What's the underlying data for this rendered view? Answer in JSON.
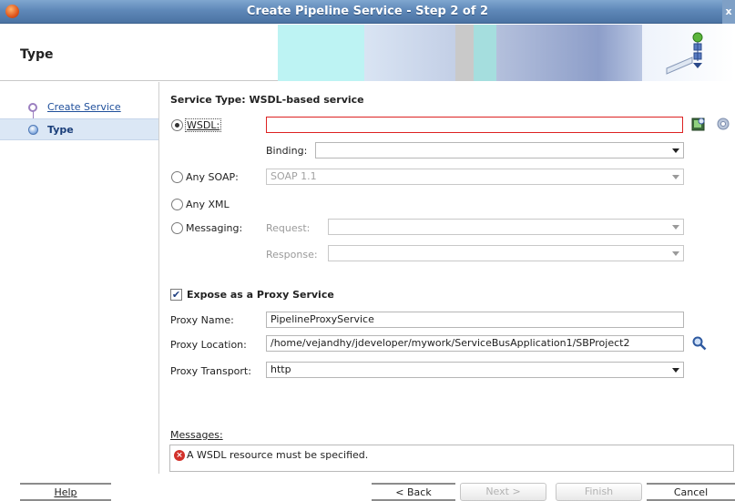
{
  "window": {
    "title": "Create Pipeline Service - Step 2 of 2",
    "close_glyph": "x"
  },
  "header": {
    "title": "Type"
  },
  "nav": {
    "items": [
      {
        "label": "Create Service"
      },
      {
        "label": "Type"
      }
    ]
  },
  "form": {
    "service_type": "Service Type: WSDL-based service",
    "wsdl": {
      "label": "WSDL:",
      "value": ""
    },
    "binding": {
      "label": "Binding:",
      "value": ""
    },
    "any_soap": {
      "label": "Any SOAP:",
      "value": "SOAP 1.1"
    },
    "any_xml": {
      "label": "Any XML"
    },
    "messaging": {
      "label": "Messaging:",
      "request_label": "Request:",
      "response_label": "Response:"
    },
    "expose": {
      "label": "Expose as a Proxy Service",
      "checked": true
    },
    "proxy_name": {
      "label": "Proxy Name:",
      "value": "PipelineProxyService"
    },
    "proxy_location": {
      "label": "Proxy Location:",
      "value": "/home/vejandhy/jdeveloper/mywork/ServiceBusApplication1/SBProject2"
    },
    "proxy_transport": {
      "label": "Proxy Transport:",
      "value": "http"
    }
  },
  "messages": {
    "label": "Messages:",
    "text": "A WSDL resource must be specified."
  },
  "buttons": {
    "help": "Help",
    "back": "< Back",
    "next": "Next >",
    "finish": "Finish",
    "cancel": "Cancel"
  },
  "colors": {
    "titlebar": "#5f88b8",
    "error": "#d22222",
    "selection": "#dbe7f5",
    "link": "#1f4f9b"
  }
}
